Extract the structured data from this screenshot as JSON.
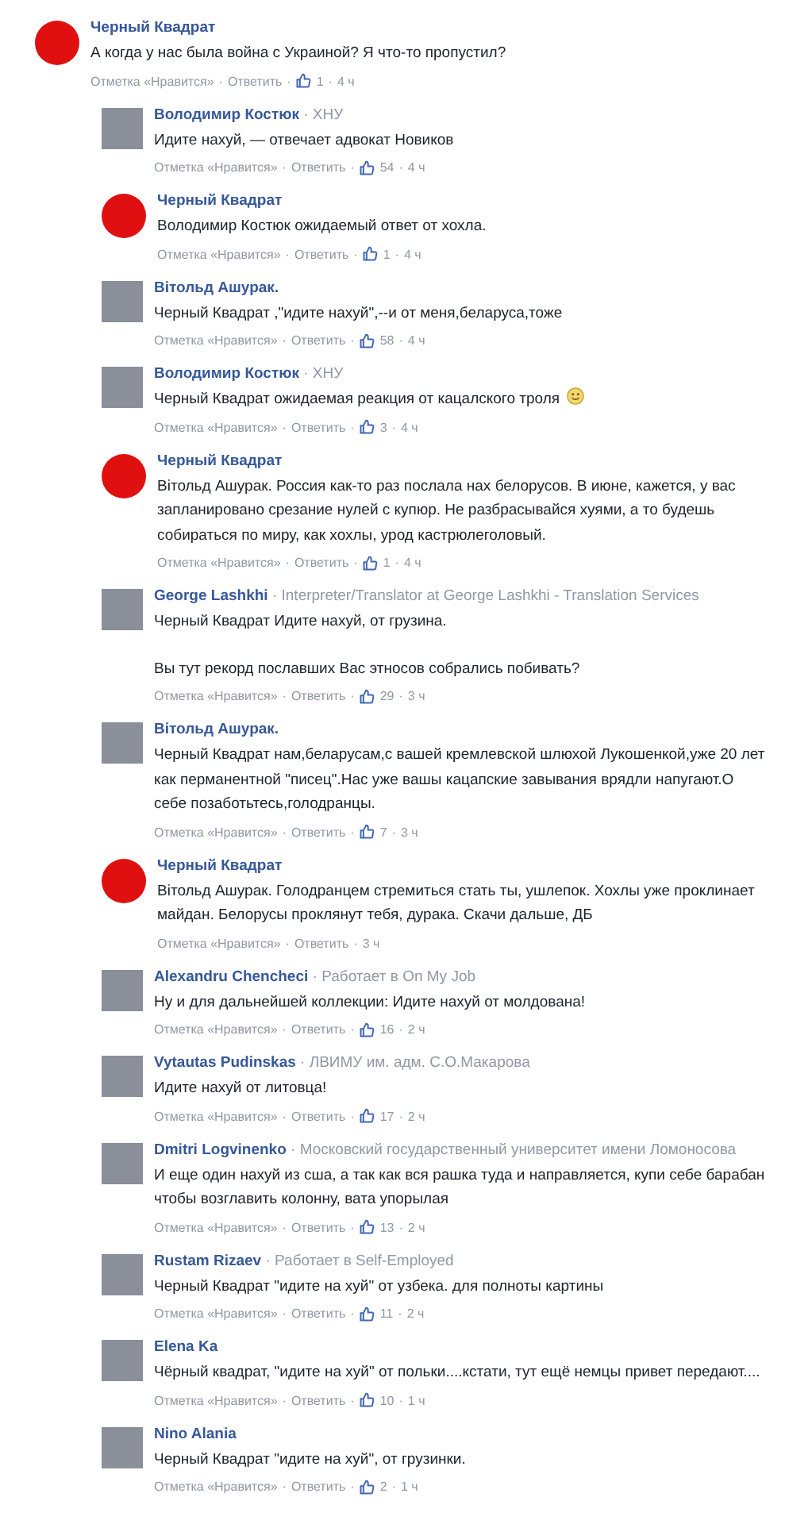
{
  "separator": "·",
  "comments": [
    {
      "author": "Черный Квадрат",
      "avatar": {
        "kind": "dot"
      },
      "reply": false,
      "paragraphs": [
        "А когда у нас была война с Украиной? Я что-то пропустил?"
      ],
      "smiley": false,
      "meta": {
        "like_link": "Отметка «Нравится»",
        "reply_link": "Ответить",
        "likes": "1",
        "time": "4 ч"
      }
    },
    {
      "author": "Володимир Костюк",
      "subtitle": "ХНУ",
      "avatar": {
        "kind": "photo"
      },
      "reply": true,
      "paragraphs": [
        "Идите нахуй, — отвечает адвокат Новиков"
      ],
      "smiley": false,
      "meta": {
        "like_link": "Отметка «Нравится»",
        "reply_link": "Ответить",
        "likes": "54",
        "time": "4 ч"
      }
    },
    {
      "author": "Черный Квадрат",
      "avatar": {
        "kind": "dot"
      },
      "reply": true,
      "paragraphs": [
        "Володимир Костюк ожидаемый ответ от хохла."
      ],
      "smiley": false,
      "meta": {
        "like_link": "Отметка «Нравится»",
        "reply_link": "Ответить",
        "likes": "1",
        "time": "4 ч"
      }
    },
    {
      "author": "Вітольд Ашурак.",
      "avatar": {
        "kind": "photo"
      },
      "reply": true,
      "paragraphs": [
        "Черный Квадрат ,\"идите нахуй\",--и от меня,беларуса,тоже"
      ],
      "smiley": false,
      "meta": {
        "like_link": "Отметка «Нравится»",
        "reply_link": "Ответить",
        "likes": "58",
        "time": "4 ч"
      }
    },
    {
      "author": "Володимир Костюк",
      "subtitle": "ХНУ",
      "avatar": {
        "kind": "photo"
      },
      "reply": true,
      "paragraphs": [
        "Черный Квадрат ожидаемая реакция от кацалского троля"
      ],
      "smiley": true,
      "meta": {
        "like_link": "Отметка «Нравится»",
        "reply_link": "Ответить",
        "likes": "3",
        "time": "4 ч"
      }
    },
    {
      "author": "Черный Квадрат",
      "avatar": {
        "kind": "dot"
      },
      "reply": true,
      "paragraphs": [
        "Вітольд Ашурак. Россия как-то раз послала нах белорусов. В июне, кажется, у вас запланировано срезание нулей с купюр. Не разбрасывайся хуями, а то будешь собираться по миру, как хохлы, урод кастрюлеголовый."
      ],
      "smiley": false,
      "meta": {
        "like_link": "Отметка «Нравится»",
        "reply_link": "Ответить",
        "likes": "1",
        "time": "4 ч"
      }
    },
    {
      "author": "George Lashkhi",
      "subtitle": "Interpreter/Translator at George Lashkhi - Translation Services",
      "avatar": {
        "kind": "photo"
      },
      "reply": true,
      "paragraphs": [
        "Черный Квадрат Идите нахуй, от грузина.",
        "Вы тут рекорд пославших Вас этносов собрались побивать?"
      ],
      "smiley": false,
      "meta": {
        "like_link": "Отметка «Нравится»",
        "reply_link": "Ответить",
        "likes": "29",
        "time": "3 ч"
      }
    },
    {
      "author": "Вітольд Ашурак.",
      "avatar": {
        "kind": "photo"
      },
      "reply": true,
      "paragraphs": [
        "Черный Квадрат нам,беларусам,с вашей кремлевской шлюхой Лукошенкой,уже 20 лет как перманентной \"писец\".Нас уже вашы кацапские завывания врядли напугают.О себе позаботьтесь,голодранцы."
      ],
      "smiley": false,
      "meta": {
        "like_link": "Отметка «Нравится»",
        "reply_link": "Ответить",
        "likes": "7",
        "time": "3 ч"
      }
    },
    {
      "author": "Черный Квадрат",
      "avatar": {
        "kind": "dot"
      },
      "reply": true,
      "paragraphs": [
        "Вітольд Ашурак. Голодранцем стремиться стать ты, ушлепок. Хохлы уже проклинает майдан. Белорусы проклянут тебя, дурака. Скачи дальше, ДБ"
      ],
      "smiley": false,
      "meta": {
        "like_link": "Отметка «Нравится»",
        "reply_link": "Ответить",
        "time": "3 ч"
      }
    },
    {
      "author": "Alexandru Chencheci",
      "subtitle": "Работает в On My Job",
      "avatar": {
        "kind": "photo"
      },
      "reply": true,
      "paragraphs": [
        "Ну и для дальнейшей коллекции: Идите нахуй от молдована!"
      ],
      "smiley": false,
      "meta": {
        "like_link": "Отметка «Нравится»",
        "reply_link": "Ответить",
        "likes": "16",
        "time": "2 ч"
      }
    },
    {
      "author": "Vytautas Pudinskas",
      "subtitle": "ЛВИМУ им. адм. С.О.Макарова",
      "avatar": {
        "kind": "photo"
      },
      "reply": true,
      "paragraphs": [
        "Идите нахуй от литовца!"
      ],
      "smiley": false,
      "meta": {
        "like_link": "Отметка «Нравится»",
        "reply_link": "Ответить",
        "likes": "17",
        "time": "2 ч"
      }
    },
    {
      "author": "Dmitri Logvinenko",
      "subtitle": "Московский государственный университет имени Ломоносова",
      "avatar": {
        "kind": "photo"
      },
      "reply": true,
      "paragraphs": [
        "И еще один нахуй из сша, а так как вся рашка туда и направляется, купи себе барабан чтобы возглавить колонну, вата упорылая"
      ],
      "smiley": false,
      "meta": {
        "like_link": "Отметка «Нравится»",
        "reply_link": "Ответить",
        "likes": "13",
        "time": "2 ч"
      }
    },
    {
      "author": "Rustam Rizaev",
      "subtitle": "Работает в Self-Employed",
      "avatar": {
        "kind": "photo"
      },
      "reply": true,
      "paragraphs": [
        "Черный Квадрат \"идите на хуй\" от узбека. для полноты картины"
      ],
      "smiley": false,
      "meta": {
        "like_link": "Отметка «Нравится»",
        "reply_link": "Ответить",
        "likes": "11",
        "time": "2 ч"
      }
    },
    {
      "author": "Elena Ka",
      "avatar": {
        "kind": "photo"
      },
      "reply": true,
      "paragraphs": [
        "Чёрный квадрат, \"идите на хуй\" от польки....кстати, тут ещё немцы привет передают...."
      ],
      "smiley": false,
      "meta": {
        "like_link": "Отметка «Нравится»",
        "reply_link": "Ответить",
        "likes": "10",
        "time": "1 ч"
      }
    },
    {
      "author": "Nino Alania",
      "avatar": {
        "kind": "photo"
      },
      "reply": true,
      "paragraphs": [
        "Черный Квадрат \"идите на хуй\", от грузинки."
      ],
      "smiley": false,
      "meta": {
        "like_link": "Отметка «Нравится»",
        "reply_link": "Ответить",
        "likes": "2",
        "time": "1 ч"
      }
    }
  ]
}
